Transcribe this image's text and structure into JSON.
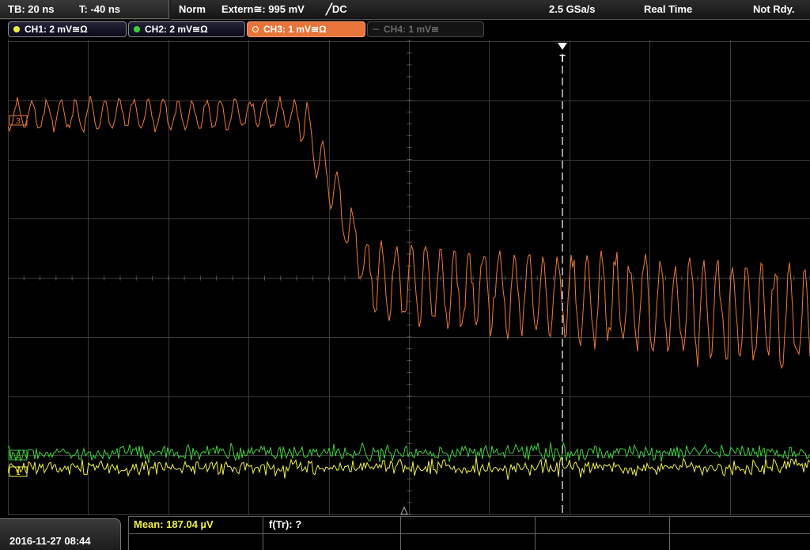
{
  "topbar": {
    "timebase": "TB: 20 ns",
    "trigger_time": "T: -40 ns",
    "mode": "Norm",
    "trigger_source": "Extern≅: 995 mV",
    "trigger_slope": "╱DC",
    "sample_rate": "2.5 GSa/s",
    "acq_mode": "Real Time",
    "status": "Not Rdy."
  },
  "channels": [
    {
      "label": "CH1: 2 mV≅Ω",
      "color": "#f2f23c",
      "state": "on"
    },
    {
      "label": "CH2: 2 mV≅Ω",
      "color": "#3cd23c",
      "state": "on"
    },
    {
      "label": "CH3: 1 mV≅Ω",
      "color": "#f07a32",
      "state": "active"
    },
    {
      "label": "CH4: 1 mV≅",
      "color": "#6a6a6a",
      "state": "off"
    }
  ],
  "trigger_marker": "T",
  "markers": {
    "ch1": "1",
    "ch2": "2",
    "ch3": "3"
  },
  "bottom": {
    "datetime": "2016-11-27 08:44",
    "mean_label": "Mean: 187.04 µV",
    "f_label": "f(Tr): ?"
  },
  "colors": {
    "ch1": "#f2f23c",
    "ch2": "#3cd23c",
    "ch3": "#f07a32",
    "grid": "#3a3a3a"
  }
}
